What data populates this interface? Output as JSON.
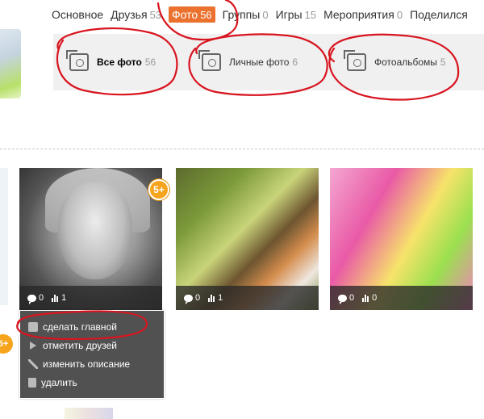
{
  "topnav": {
    "items": [
      {
        "label": "Основное",
        "count": ""
      },
      {
        "label": "Друзья",
        "count": "53"
      },
      {
        "label": "Фото",
        "count": "56"
      },
      {
        "label": "Группы",
        "count": "0"
      },
      {
        "label": "Игры",
        "count": "15"
      },
      {
        "label": "Мероприятия",
        "count": "0"
      },
      {
        "label": "Поделился",
        "count": ""
      }
    ],
    "active_index": 2,
    "active_color": "#eb722e"
  },
  "subtabs": [
    {
      "label": "Все фото",
      "count": "56",
      "icon": "photos-icon"
    },
    {
      "label": "Личные фото",
      "count": "6",
      "icon": "camera-icon"
    },
    {
      "label": "Фотоальбомы",
      "count": "5",
      "icon": "albums-icon"
    }
  ],
  "photos": [
    {
      "comments": "0",
      "views": "1",
      "badge": "5+"
    },
    {
      "comments": "0",
      "views": "1",
      "badge": ""
    },
    {
      "comments": "0",
      "views": "0",
      "badge": ""
    }
  ],
  "menu": {
    "items": [
      {
        "label": "сделать главной",
        "icon": "person-icon"
      },
      {
        "label": "отметить друзей",
        "icon": "flag-icon"
      },
      {
        "label": "изменить описание",
        "icon": "pencil-icon"
      },
      {
        "label": "удалить",
        "icon": "trash-icon"
      }
    ]
  },
  "left_badge": "5+",
  "annotation_color": "#d8141f"
}
